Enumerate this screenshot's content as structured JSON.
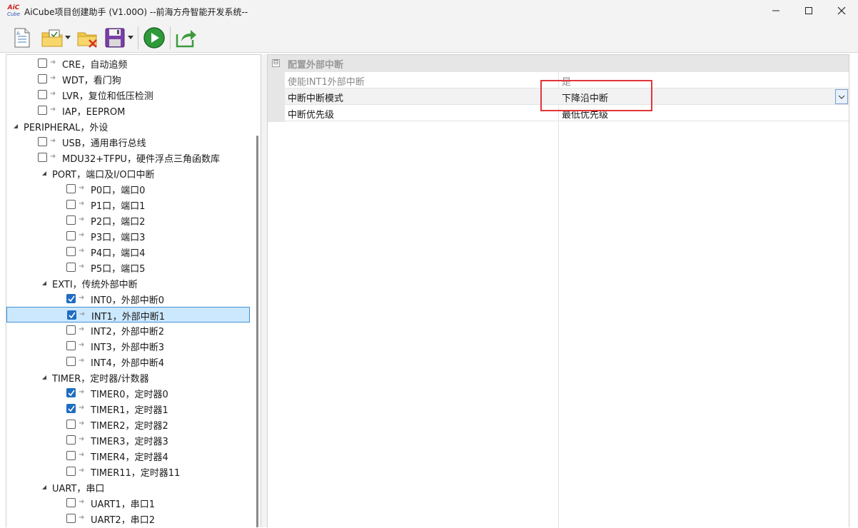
{
  "window": {
    "logo_line1": "AiC",
    "logo_line2": "Cube",
    "title": "AiCube项目创建助手 (V1.00O) --前海方舟智能开发系统--",
    "minimize_glyph": "—",
    "maximize_glyph": "☐",
    "close_glyph": "✕"
  },
  "toolbar": {
    "buttons": [
      {
        "name": "new-document-icon"
      },
      {
        "name": "open-project-icon"
      },
      {
        "name": "close-project-icon"
      },
      {
        "name": "save-icon"
      },
      {
        "name": "run-icon"
      },
      {
        "name": "export-icon"
      }
    ]
  },
  "tree": {
    "items": [
      {
        "label": "CRE，自动追频",
        "level": 2,
        "checkbox": true,
        "checked": false,
        "expander": ""
      },
      {
        "label": "WDT，看门狗",
        "level": 2,
        "checkbox": true,
        "checked": false,
        "expander": ""
      },
      {
        "label": "LVR，复位和低压检测",
        "level": 2,
        "checkbox": true,
        "checked": false,
        "expander": ""
      },
      {
        "label": "IAP，EEPROM",
        "level": 2,
        "checkbox": true,
        "checked": false,
        "expander": ""
      },
      {
        "label": "PERIPHERAL，外设",
        "level": 1,
        "checkbox": false,
        "checked": false,
        "expander": "◢"
      },
      {
        "label": "USB，通用串行总线",
        "level": 2,
        "checkbox": true,
        "checked": false,
        "expander": ""
      },
      {
        "label": "MDU32+TFPU，硬件浮点三角函数库",
        "level": 2,
        "checkbox": true,
        "checked": false,
        "expander": ""
      },
      {
        "label": "PORT，端口及I/O口中断",
        "level": 2,
        "checkbox": false,
        "checked": false,
        "expander": "◢"
      },
      {
        "label": "P0口，端口0",
        "level": 3,
        "checkbox": true,
        "checked": false,
        "expander": ""
      },
      {
        "label": "P1口，端口1",
        "level": 3,
        "checkbox": true,
        "checked": false,
        "expander": ""
      },
      {
        "label": "P2口，端口2",
        "level": 3,
        "checkbox": true,
        "checked": false,
        "expander": ""
      },
      {
        "label": "P3口，端口3",
        "level": 3,
        "checkbox": true,
        "checked": false,
        "expander": ""
      },
      {
        "label": "P4口，端口4",
        "level": 3,
        "checkbox": true,
        "checked": false,
        "expander": ""
      },
      {
        "label": "P5口，端口5",
        "level": 3,
        "checkbox": true,
        "checked": false,
        "expander": ""
      },
      {
        "label": "EXTI，传统外部中断",
        "level": 2,
        "checkbox": false,
        "checked": false,
        "expander": "◢"
      },
      {
        "label": "INT0，外部中断0",
        "level": 3,
        "checkbox": true,
        "checked": true,
        "expander": ""
      },
      {
        "label": "INT1，外部中断1",
        "level": 3,
        "checkbox": true,
        "checked": true,
        "expander": "",
        "selected": true
      },
      {
        "label": "INT2，外部中断2",
        "level": 3,
        "checkbox": true,
        "checked": false,
        "expander": ""
      },
      {
        "label": "INT3，外部中断3",
        "level": 3,
        "checkbox": true,
        "checked": false,
        "expander": ""
      },
      {
        "label": "INT4，外部中断4",
        "level": 3,
        "checkbox": true,
        "checked": false,
        "expander": ""
      },
      {
        "label": "TIMER，定时器/计数器",
        "level": 2,
        "checkbox": false,
        "checked": false,
        "expander": "◢"
      },
      {
        "label": "TIMER0，定时器0",
        "level": 3,
        "checkbox": true,
        "checked": true,
        "expander": ""
      },
      {
        "label": "TIMER1，定时器1",
        "level": 3,
        "checkbox": true,
        "checked": true,
        "expander": ""
      },
      {
        "label": "TIMER2，定时器2",
        "level": 3,
        "checkbox": true,
        "checked": false,
        "expander": ""
      },
      {
        "label": "TIMER3，定时器3",
        "level": 3,
        "checkbox": true,
        "checked": false,
        "expander": ""
      },
      {
        "label": "TIMER4，定时器4",
        "level": 3,
        "checkbox": true,
        "checked": false,
        "expander": ""
      },
      {
        "label": "TIMER11，定时器11",
        "level": 3,
        "checkbox": true,
        "checked": false,
        "expander": ""
      },
      {
        "label": "UART，串口",
        "level": 2,
        "checkbox": false,
        "checked": false,
        "expander": "◢"
      },
      {
        "label": "UART1，串口1",
        "level": 3,
        "checkbox": true,
        "checked": false,
        "expander": ""
      },
      {
        "label": "UART2，串口2",
        "level": 3,
        "checkbox": true,
        "checked": false,
        "expander": ""
      }
    ]
  },
  "properties": {
    "category_toggle": "⊟",
    "category": "配置外部中断",
    "rows": [
      {
        "name": "使能INT1外部中断",
        "value": "是",
        "readonly": true
      },
      {
        "name": "中断中断模式",
        "value": "下降沿中断",
        "readonly": false,
        "selected": true
      },
      {
        "name": "中断优先级",
        "value": "最低优先级",
        "readonly": false
      }
    ]
  },
  "colors": {
    "checkbox_checked": "#1f6dc2",
    "selection_bg": "#cce8ff",
    "highlight_box": "#e0353a"
  }
}
